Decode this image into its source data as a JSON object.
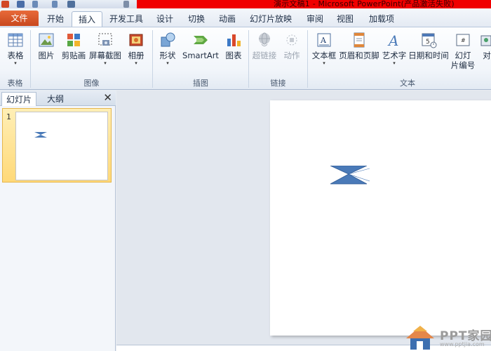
{
  "window": {
    "title": "演示文稿1 - Microsoft PowerPoint(产品激活失败)"
  },
  "tabs": [
    {
      "label": "文件"
    },
    {
      "label": "开始"
    },
    {
      "label": "插入"
    },
    {
      "label": "开发工具"
    },
    {
      "label": "设计"
    },
    {
      "label": "切换"
    },
    {
      "label": "动画"
    },
    {
      "label": "幻灯片放映"
    },
    {
      "label": "审阅"
    },
    {
      "label": "视图"
    },
    {
      "label": "加载项"
    }
  ],
  "active_tab": "插入",
  "ribbon": {
    "groups": {
      "tables": "表格",
      "images": "图像",
      "illustrations": "插图",
      "links": "链接",
      "text": "文本"
    },
    "buttons": {
      "table": "表格",
      "picture": "图片",
      "clipart": "剪贴画",
      "screenshot": "屏幕截图",
      "album": "相册",
      "shapes": "形状",
      "smartart": "SmartArt",
      "chart": "图表",
      "hyperlink": "超链接",
      "action": "动作",
      "textbox": "文本框",
      "header_footer": "页眉和页脚",
      "wordart": "艺术字",
      "datetime": "日期和时间",
      "slide_number_l1": "幻灯",
      "slide_number_l2": "片编号",
      "object": "对"
    }
  },
  "left_panel": {
    "tabs": [
      "幻灯片",
      "大纲"
    ],
    "close_glyph": "✕",
    "slide_number": "1"
  },
  "watermark": {
    "name": "PPT家园",
    "url": "www.pptjia.com"
  },
  "colors": {
    "accent_red": "#f00000",
    "file_tab": "#d4562a",
    "shape_fill": "#4a7ab8",
    "selection": "#ffd978"
  }
}
